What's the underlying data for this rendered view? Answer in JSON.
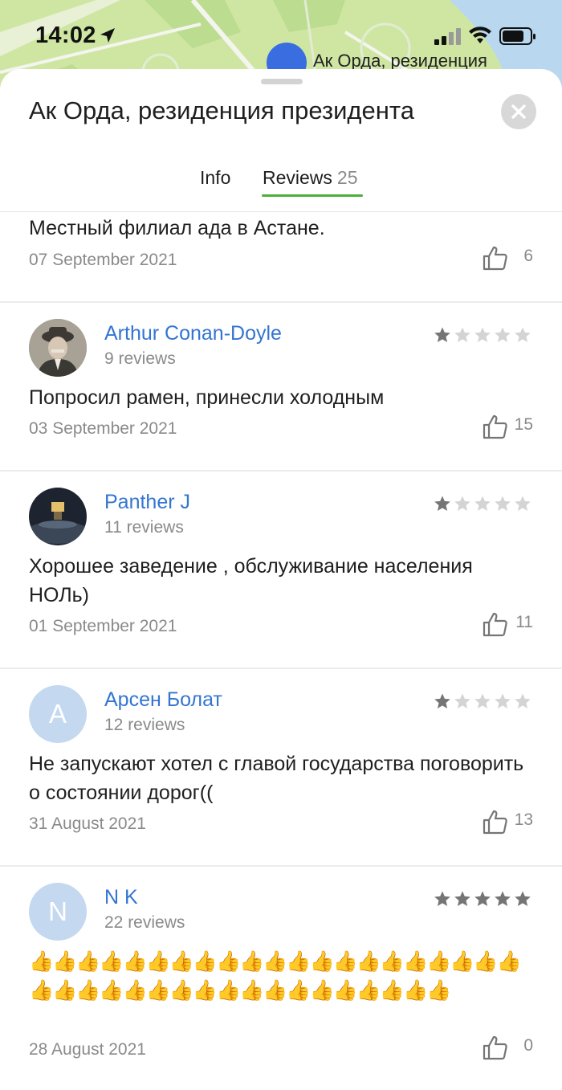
{
  "status": {
    "time": "14:02"
  },
  "map": {
    "label": "Ак Орда, резиденция"
  },
  "sheet": {
    "title": "Ак Орда, резиденция президента",
    "close_icon": "close-icon"
  },
  "tabs": [
    {
      "label": "Info"
    },
    {
      "label": "Reviews",
      "count": "25"
    }
  ],
  "reviews": [
    {
      "text": "Местный филиал ада в Астане.",
      "date": "07 September 2021",
      "likes": "6"
    },
    {
      "author": "Arthur Conan-Doyle",
      "count": "9 reviews",
      "avatar": "photo",
      "rating": 1,
      "text": "Попросил рамен, принесли холодным",
      "date": "03 September 2021",
      "likes": "15"
    },
    {
      "author": "Panther J",
      "count": "11 reviews",
      "avatar": "photo",
      "rating": 1,
      "text": "Хорошее заведение , обслуживание населения НОЛь)",
      "date": "01 September 2021",
      "likes": "11"
    },
    {
      "author": "Арсен Болат",
      "count": "12 reviews",
      "avatar": "A",
      "rating": 1,
      "text": "Не запускают хотел с главой государства поговорить о состоянии дорог((",
      "date": "31 August 2021",
      "likes": "13"
    },
    {
      "author": "N K",
      "count": "22 reviews",
      "avatar": "N",
      "rating": 5,
      "text": "👍👍👍👍👍👍👍👍👍👍👍👍👍👍👍👍👍👍👍👍👍👍👍👍👍👍👍👍👍👍👍👍👍👍👍👍👍👍👍",
      "date": "28 August 2021",
      "likes": "0"
    }
  ],
  "colors": {
    "accent_link": "#3475d2",
    "tab_underline": "#4caf3a",
    "star_filled": "#757575",
    "star_empty": "#d4d4d4",
    "avatar_bg": "#c4d8ef"
  }
}
